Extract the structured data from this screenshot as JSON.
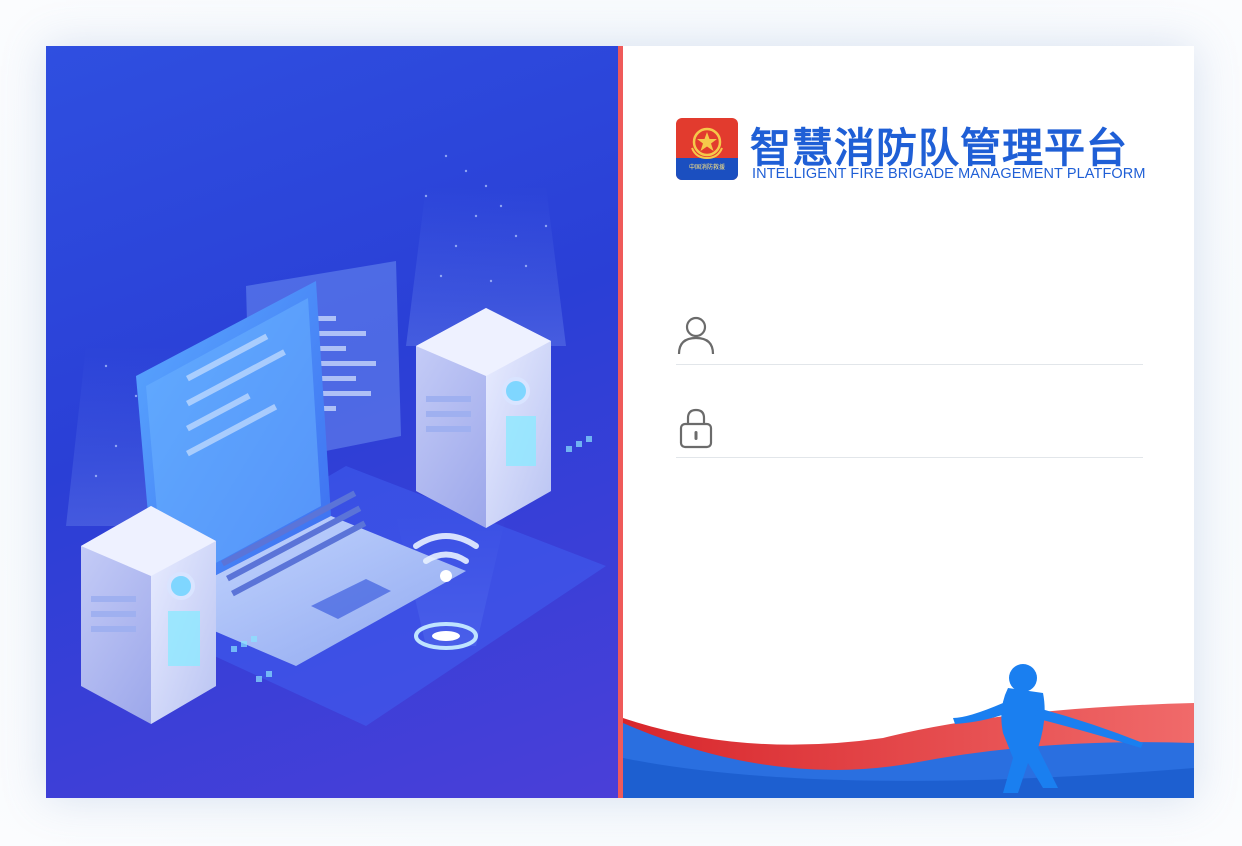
{
  "brand": {
    "title_cn": "智慧消防队管理平台",
    "title_en": "INTELLIGENT FIRE BRIGADE MANAGEMENT PLATFORM",
    "emblem_text": "中国消防救援",
    "emblem_icon": "fire-rescue-emblem-icon"
  },
  "login": {
    "username": {
      "value": "",
      "placeholder": "",
      "icon": "user-icon"
    },
    "password": {
      "value": "",
      "placeholder": "",
      "icon": "lock-icon"
    }
  },
  "colors": {
    "brand_blue": "#1f5fd6",
    "panel_blue": "#2f4fe0",
    "accent_red": "#ef5a5a",
    "wave_blue": "#2a6fe0",
    "firefighter_blue": "#1a7ff0"
  }
}
